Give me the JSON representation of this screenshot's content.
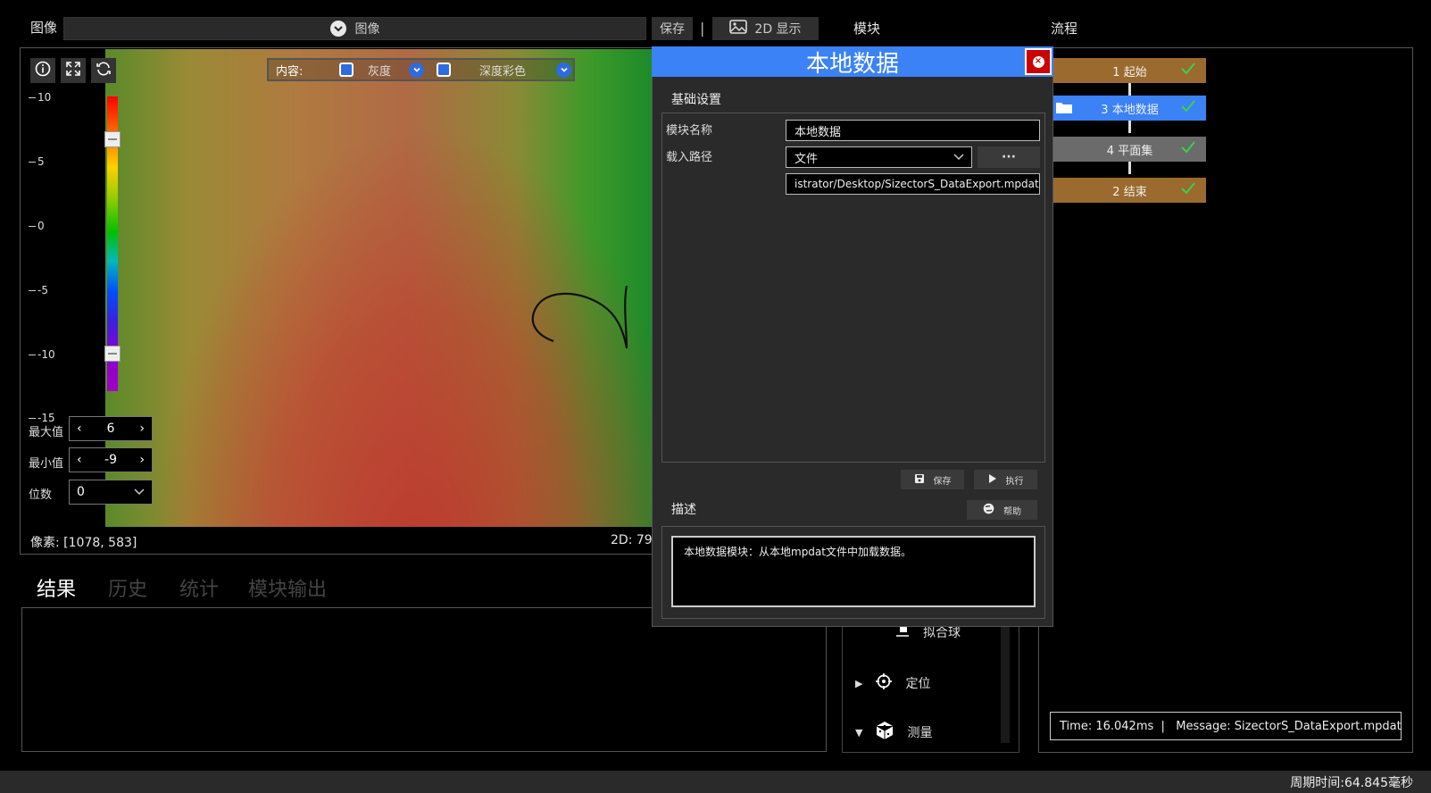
{
  "header": {
    "image_label": "图像",
    "image_select_value": "图像",
    "save_label": "保存",
    "separator": "|",
    "display_2d_label": "2D 显示",
    "modules_label": "模块",
    "flow_label": "流程"
  },
  "viewer": {
    "toolbar": {
      "info_icon": "info-icon",
      "fullscreen_icon": "expand-icon",
      "refresh_icon": "refresh-icon"
    },
    "content_label": "内容:",
    "options": [
      {
        "label": "灰度",
        "checked": true
      },
      {
        "label": "深度彩色",
        "checked": true
      }
    ],
    "scale_ticks": [
      "10",
      "5",
      "0",
      "-5",
      "-10",
      "-15"
    ],
    "max_label": "最大值",
    "max_value": "6",
    "min_label": "最小值",
    "min_value": "-9",
    "digits_label": "位数",
    "digits_value": "0",
    "pixel_readout": "像素: [1078, 583]",
    "coord_2d": "2D: 79,"
  },
  "results": {
    "tabs": [
      "结果",
      "历史",
      "统计",
      "模块输出"
    ],
    "active_tab": "结果"
  },
  "modules": {
    "partial_item": "拟合球",
    "items": [
      {
        "label": "定位",
        "expanded": false
      },
      {
        "label": "测量",
        "expanded": true
      }
    ]
  },
  "flow": {
    "nodes": [
      {
        "label": "1 起始",
        "color": "#9b6a2e",
        "checked": true
      },
      {
        "label": "3 本地数据",
        "color": "#3b82f6",
        "checked": true,
        "has_folder_icon": true
      },
      {
        "label": "4 平面集",
        "color": "#6b6b6b",
        "checked": true
      },
      {
        "label": "2 结束",
        "color": "#9b6a2e",
        "checked": true
      }
    ],
    "status": "Time: 16.042ms  |   Message: SizectorS_DataExport.mpdat"
  },
  "dialog": {
    "title": "本地数据",
    "basic_settings": "基础设置",
    "module_name_label": "模块名称",
    "module_name_value": "本地数据",
    "load_path_label": "载入路径",
    "load_path_type": "文件",
    "browse_label": "···",
    "path_value": "istrator/Desktop/SizectorS_DataExport.mpdat",
    "save_label": "保存",
    "run_label": "执行",
    "desc_label": "描述",
    "help_label": "帮助",
    "description": "本地数据模块：从本地mpdat文件中加载数据。"
  },
  "footer": {
    "cycle_time": "周期时间:64.845毫秒"
  },
  "colors": {
    "accent_blue": "#3b82f6",
    "close_red": "#cc0000",
    "flow_brown": "#9b6a2e",
    "check_green": "#3cd04a"
  }
}
